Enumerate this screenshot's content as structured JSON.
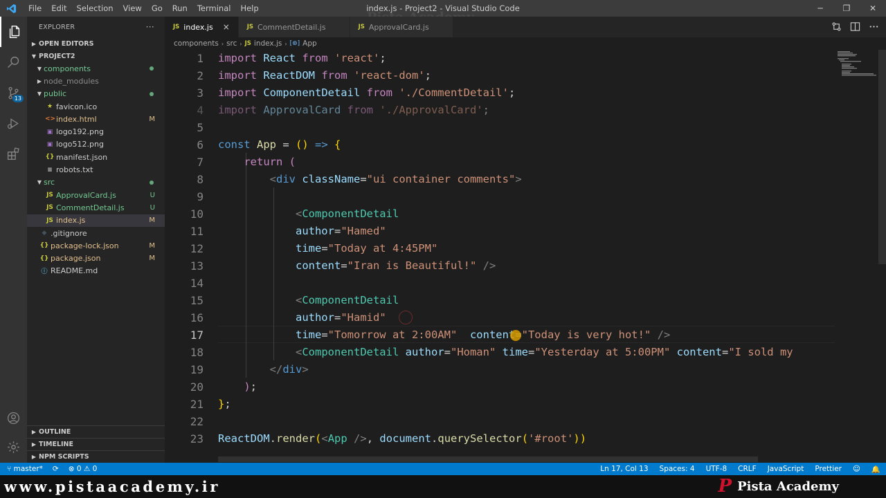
{
  "titlebar": {
    "menu": [
      "File",
      "Edit",
      "Selection",
      "View",
      "Go",
      "Run",
      "Terminal",
      "Help"
    ],
    "title": "index.js - Project2 - Visual Studio Code",
    "controls": {
      "minimize": "─",
      "restore": "❐",
      "close": "✕"
    }
  },
  "activity": {
    "scm_badge": "13",
    "icons": [
      "files-icon",
      "search-icon",
      "source-control-icon",
      "run-debug-icon",
      "extensions-icon",
      "account-icon",
      "settings-gear-icon"
    ]
  },
  "sidebar": {
    "header": "EXPLORER",
    "more": "···",
    "open_editors": "OPEN EDITORS",
    "project": "PROJECT2",
    "tree": [
      {
        "label": "components",
        "depth": 1,
        "type": "folder",
        "open": true,
        "color": "#73c991",
        "dot": "#73c991"
      },
      {
        "label": "node_modules",
        "depth": 1,
        "type": "folder",
        "open": false,
        "color": "#8c8c8c"
      },
      {
        "label": "public",
        "depth": 1,
        "type": "folder",
        "open": true,
        "color": "#73c991",
        "dot": "#73c991"
      },
      {
        "label": "favicon.ico",
        "depth": 2,
        "type": "file",
        "icon": "★",
        "iconColor": "#cbcb41",
        "color": "#cccccc"
      },
      {
        "label": "index.html",
        "depth": 2,
        "type": "file",
        "icon": "<>",
        "iconColor": "#e37933",
        "color": "#e2c08d",
        "status": "M"
      },
      {
        "label": "logo192.png",
        "depth": 2,
        "type": "file",
        "icon": "▣",
        "iconColor": "#a074c4",
        "color": "#cccccc"
      },
      {
        "label": "logo512.png",
        "depth": 2,
        "type": "file",
        "icon": "▣",
        "iconColor": "#a074c4",
        "color": "#cccccc"
      },
      {
        "label": "manifest.json",
        "depth": 2,
        "type": "file",
        "icon": "{}",
        "iconColor": "#cbcb41",
        "color": "#cccccc"
      },
      {
        "label": "robots.txt",
        "depth": 2,
        "type": "file",
        "icon": "≡",
        "iconColor": "#cccccc",
        "color": "#cccccc"
      },
      {
        "label": "src",
        "depth": 1,
        "type": "folder",
        "open": true,
        "color": "#73c991",
        "dot": "#73c991"
      },
      {
        "label": "ApprovalCard.js",
        "depth": 2,
        "type": "file",
        "icon": "JS",
        "iconColor": "#cbcb41",
        "color": "#73c991",
        "status": "U"
      },
      {
        "label": "CommentDetail.js",
        "depth": 2,
        "type": "file",
        "icon": "JS",
        "iconColor": "#cbcb41",
        "color": "#73c991",
        "status": "U"
      },
      {
        "label": "index.js",
        "depth": 2,
        "type": "file",
        "icon": "JS",
        "iconColor": "#cbcb41",
        "color": "#e2c08d",
        "status": "M",
        "selected": true
      },
      {
        "label": ".gitignore",
        "depth": 1,
        "type": "file",
        "icon": "◆",
        "iconColor": "#41535b",
        "color": "#cccccc"
      },
      {
        "label": "package-lock.json",
        "depth": 1,
        "type": "file",
        "icon": "{}",
        "iconColor": "#cbcb41",
        "color": "#e2c08d",
        "status": "M"
      },
      {
        "label": "package.json",
        "depth": 1,
        "type": "file",
        "icon": "{}",
        "iconColor": "#cbcb41",
        "color": "#e2c08d",
        "status": "M"
      },
      {
        "label": "README.md",
        "depth": 1,
        "type": "file",
        "icon": "ⓘ",
        "iconColor": "#519aba",
        "color": "#cccccc"
      }
    ],
    "outline": "OUTLINE",
    "timeline": "TIMELINE",
    "npm": "NPM SCRIPTS"
  },
  "tabs": [
    {
      "label": "index.js",
      "active": true,
      "close": "×"
    },
    {
      "label": "CommentDetail.js",
      "active": false
    },
    {
      "label": "ApprovalCard.js",
      "active": false
    }
  ],
  "breadcrumbs": [
    "components",
    "src",
    "index.js",
    "App"
  ],
  "breadcrumb_icons": {
    "file": "JS",
    "symbol": "[⊛]"
  },
  "editor": {
    "current_line": 17,
    "lines": [
      {
        "n": "1",
        "t": [
          [
            "kw",
            "import "
          ],
          [
            "id",
            "React "
          ],
          [
            "kw",
            "from "
          ],
          [
            "str",
            "'react'"
          ],
          [
            "",
            "; "
          ]
        ]
      },
      {
        "n": "2",
        "t": [
          [
            "kw",
            "import "
          ],
          [
            "id",
            "ReactDOM "
          ],
          [
            "kw",
            "from "
          ],
          [
            "str",
            "'react-dom'"
          ],
          [
            "",
            ";"
          ]
        ]
      },
      {
        "n": "3",
        "t": [
          [
            "kw",
            "import "
          ],
          [
            "id",
            "ComponentDetail "
          ],
          [
            "kw",
            "from "
          ],
          [
            "str",
            "'./CommentDetail'"
          ],
          [
            "",
            ";"
          ]
        ]
      },
      {
        "n": "4",
        "faded": true,
        "t": [
          [
            "kw",
            "import "
          ],
          [
            "id",
            "ApprovalCard "
          ],
          [
            "kw",
            "from "
          ],
          [
            "str",
            "'./ApprovalCard'"
          ],
          [
            "",
            ";"
          ]
        ]
      },
      {
        "n": "5",
        "t": []
      },
      {
        "n": "6",
        "t": [
          [
            "kw2",
            "const "
          ],
          [
            "fn",
            "App "
          ],
          [
            "",
            "= "
          ],
          [
            "yl",
            "()"
          ],
          [
            "",
            " "
          ],
          [
            "kw2",
            "=>"
          ],
          [
            "",
            " "
          ],
          [
            "yl",
            "{"
          ]
        ]
      },
      {
        "n": "7",
        "t": [
          [
            "",
            "    "
          ],
          [
            "kw",
            "return "
          ],
          [
            "kw",
            "("
          ]
        ]
      },
      {
        "n": "8",
        "t": [
          [
            "",
            "        "
          ],
          [
            "tag",
            "<"
          ],
          [
            "kw2",
            "div "
          ],
          [
            "id",
            "className"
          ],
          [
            "",
            "="
          ],
          [
            "str",
            "\"ui container comments\""
          ],
          [
            "tag",
            ">"
          ]
        ]
      },
      {
        "n": "9",
        "t": []
      },
      {
        "n": "10",
        "t": [
          [
            "",
            "            "
          ],
          [
            "tag",
            "<"
          ],
          [
            "cls",
            "ComponentDetail"
          ]
        ]
      },
      {
        "n": "11",
        "t": [
          [
            "",
            "            "
          ],
          [
            "id",
            "author"
          ],
          [
            "",
            "="
          ],
          [
            "str",
            "\"Hamed\""
          ]
        ]
      },
      {
        "n": "12",
        "t": [
          [
            "",
            "            "
          ],
          [
            "id",
            "time"
          ],
          [
            "",
            "="
          ],
          [
            "str",
            "\"Today at 4:45PM\""
          ]
        ]
      },
      {
        "n": "13",
        "t": [
          [
            "",
            "            "
          ],
          [
            "id",
            "content"
          ],
          [
            "",
            "="
          ],
          [
            "str",
            "\"Iran is Beautiful!\""
          ],
          [
            "",
            " "
          ],
          [
            "tag",
            "/>"
          ]
        ]
      },
      {
        "n": "14",
        "t": []
      },
      {
        "n": "15",
        "t": [
          [
            "",
            "            "
          ],
          [
            "tag",
            "<"
          ],
          [
            "cls",
            "ComponentDetail"
          ]
        ]
      },
      {
        "n": "16",
        "t": [
          [
            "",
            "            "
          ],
          [
            "id",
            "author"
          ],
          [
            "",
            "="
          ],
          [
            "str",
            "\"Hamid\""
          ]
        ]
      },
      {
        "n": "17",
        "t": [
          [
            "",
            "            "
          ],
          [
            "id",
            "time"
          ],
          [
            "",
            "="
          ],
          [
            "str",
            "\"Tomorrow at 2:00AM\""
          ],
          [
            "",
            "  "
          ],
          [
            "id",
            "content"
          ],
          [
            "",
            "="
          ],
          [
            "str",
            "\"Today is very hot!\""
          ],
          [
            "",
            " "
          ],
          [
            "tag",
            "/>"
          ]
        ]
      },
      {
        "n": "18",
        "t": [
          [
            "",
            "            "
          ],
          [
            "tag",
            "<"
          ],
          [
            "cls",
            "ComponentDetail "
          ],
          [
            "id",
            "author"
          ],
          [
            "",
            "="
          ],
          [
            "str",
            "\"Homan\""
          ],
          [
            "",
            " "
          ],
          [
            "id",
            "time"
          ],
          [
            "",
            "="
          ],
          [
            "str",
            "\"Yesterday at 5:00PM\""
          ],
          [
            "",
            " "
          ],
          [
            "id",
            "content"
          ],
          [
            "",
            "="
          ],
          [
            "str",
            "\"I sold my"
          ]
        ]
      },
      {
        "n": "19",
        "t": [
          [
            "",
            "        "
          ],
          [
            "tag",
            "</"
          ],
          [
            "kw2",
            "div"
          ],
          [
            "tag",
            ">"
          ]
        ]
      },
      {
        "n": "20",
        "t": [
          [
            "",
            "    "
          ],
          [
            "kw",
            ")"
          ],
          [
            "",
            ";"
          ]
        ]
      },
      {
        "n": "21",
        "t": [
          [
            "yl",
            "}"
          ],
          [
            "",
            ";"
          ]
        ]
      },
      {
        "n": "22",
        "t": []
      },
      {
        "n": "23",
        "t": [
          [
            "id",
            "ReactDOM"
          ],
          [
            "",
            "."
          ],
          [
            "fn",
            "render"
          ],
          [
            "yl",
            "("
          ],
          [
            "tag",
            "<"
          ],
          [
            "cls",
            "App "
          ],
          [
            "tag",
            "/>"
          ],
          [
            "",
            ", "
          ],
          [
            "id",
            "document"
          ],
          [
            "",
            "."
          ],
          [
            "fn",
            "querySelector"
          ],
          [
            "yl",
            "("
          ],
          [
            "str",
            "'#root'"
          ],
          [
            "yl",
            "))"
          ]
        ]
      }
    ]
  },
  "statusbar": {
    "branch": "master*",
    "sync": "⟳",
    "errors": "0",
    "warnings": "0",
    "position": "Ln 17, Col 13",
    "spaces": "Spaces: 4",
    "encoding": "UTF-8",
    "eol": "CRLF",
    "language": "JavaScript",
    "formatter": "Prettier"
  },
  "branding": {
    "url": "www.pistaacademy.ir",
    "name": "Pista Academy",
    "logo_letter": "P",
    "watermark": "Pista Academy"
  },
  "colors": {
    "statusbar": "#007acc",
    "accent": "#0e639c",
    "modified": "#e2c08d",
    "untracked": "#73c991",
    "brand_red": "#d0112b"
  }
}
